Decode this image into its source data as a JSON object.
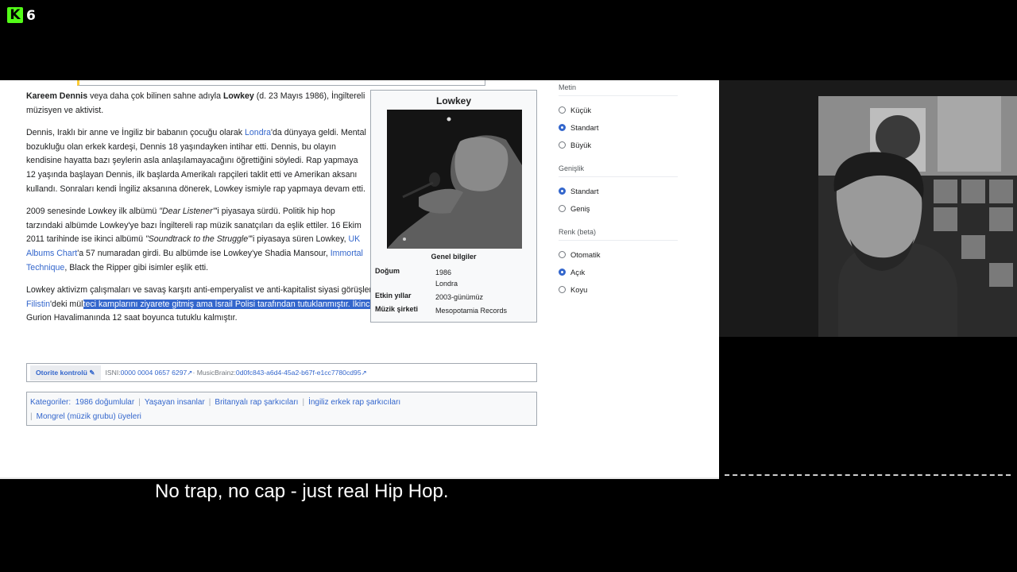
{
  "overlay": {
    "logo_letter": "K",
    "logo_number": "6",
    "subtitle": "No trap, no cap - just real Hip Hop."
  },
  "article": {
    "p1": {
      "name": "Kareem Dennis",
      "t1": " veya daha çok bilinen sahne adıyla ",
      "stage": "Lowkey",
      "t2": " (d. 23 Mayıs 1986), İngiltereli müzisyen ve aktivist."
    },
    "p2": {
      "t1": "Dennis, Iraklı bir anne ve İngiliz bir babanın çocuğu olarak ",
      "link_londra": "Londra",
      "t2": "'da dünyaya geldi. Mental bozukluğu olan erkek kardeşi, Dennis 18 yaşındayken intihar etti. Dennis, bu olayın kendisine hayatta bazı şeylerin asla anlaşılamayacağını öğrettiğini söyledi. Rap yapmaya 12 yaşında başlayan Dennis, ilk başlarda Amerikalı rapçileri taklit etti ve Amerikan aksanı kullandı. Sonraları kendi İngiliz aksanına dönerek, Lowkey ismiyle rap yapmaya devam etti."
    },
    "p3": {
      "t1": "2009 senesinde Lowkey ilk albümü ",
      "album1": "\"Dear Listener\"",
      "t2": "'i piyasaya sürdü. Politik hip hop tarzındaki albümde Lowkey'ye bazı İngiltereli rap müzik sanatçıları da eşlik ettiler. 16 Ekim 2011 tarihinde ise ikinci albümü ",
      "album2": "\"Soundtrack to the Struggle\"",
      "t3": "'i piyasaya süren Lowkey, ",
      "link_uk": "UK Albums Chart",
      "t4": "'a 57 numaradan girdi. Bu albümde ise Lowkey'ye Shadia Mansour, ",
      "link_immortal": "Immortal Technique",
      "t5": ", Black the Ripper gibi isimler eşlik etti."
    },
    "p4": {
      "t1": "Lowkey aktivizm çalışmaları ve savaş karşıtı anti-emperyalist ve anti-kapitalist siyasi görüşleriyle bilinmektedir. Şubat 2009'da ",
      "link_filistin": "Filistin",
      "t2": "'deki mül",
      "hl": "teci kamplarını ziyarete gitmiş ama İsrail Polisi tarafından tutuklanmıştır. İkinci bir kez de Temmuz 2010",
      "t3": "'da Ben Gurion Havalimanında 12 saat boyunca tutuklu kalmıştır."
    }
  },
  "infobox": {
    "title": "Lowkey",
    "section": "Genel bilgiler",
    "rows": [
      {
        "label": "Doğum",
        "value1": "1986",
        "value2": "Londra"
      },
      {
        "label": "Etkin yıllar",
        "value1": "2003-günümüz"
      },
      {
        "label": "Müzik şirketi",
        "value1": "Mesopotamia Records"
      }
    ]
  },
  "authority": {
    "button": "Otorite kontrolü",
    "isni_label": "ISNI: ",
    "isni_value": "0000 0004 0657 6297",
    "mb_label": " · MusicBrainz: ",
    "mb_value": "0d0fc843-a6d4-45a2-b67f-e1cc7780cd95"
  },
  "categories": {
    "label": "Kategoriler",
    "items": [
      "1986 doğumlular",
      "Yaşayan insanlar",
      "Britanyalı rap şarkıcıları",
      "İngiliz erkek rap şarkıcıları",
      "Mongrel (müzik grubu) üyeleri"
    ]
  },
  "sidebar": {
    "text_head": "Metin",
    "text_options": [
      "Küçük",
      "Standart",
      "Büyük"
    ],
    "text_selected": 1,
    "width_head": "Genişlik",
    "width_options": [
      "Standart",
      "Geniş"
    ],
    "width_selected": 0,
    "color_head": "Renk (beta)",
    "color_options": [
      "Otomatik",
      "Açık",
      "Koyu"
    ],
    "color_selected": 1
  },
  "colors": {
    "link": "#3366cc",
    "highlight": "#3366cc",
    "logo": "#53fc18"
  }
}
